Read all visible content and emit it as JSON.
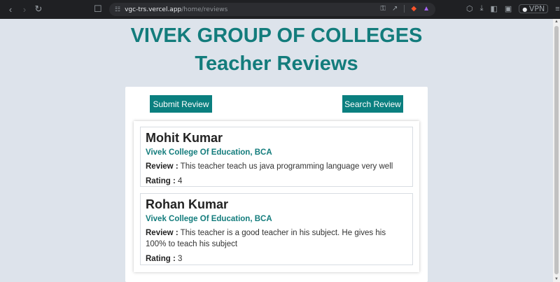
{
  "browser": {
    "url_host": "vgc-trs.vercel.app",
    "url_path": "/home/reviews",
    "vpn_label": "VPN"
  },
  "header": {
    "college": "VIVEK GROUP OF COLLEGES",
    "subtitle": "Teacher Reviews"
  },
  "actions": {
    "submit_label": "Submit Review",
    "search_label": "Search Review"
  },
  "labels": {
    "review": "Review :",
    "rating": "Rating :"
  },
  "reviews": [
    {
      "name": "Mohit Kumar",
      "college": "Vivek College Of Education, BCA",
      "review": "This teacher teach us java programming language very well",
      "rating": "4"
    },
    {
      "name": "Rohan Kumar",
      "college": "Vivek College Of Education, BCA",
      "review": "This teacher is a good teacher in his subject. He gives his 100% to teach his subject",
      "rating": "3"
    }
  ],
  "colors": {
    "accent": "#137c7c",
    "button": "#0a7f7f",
    "background": "#dde3eb"
  }
}
